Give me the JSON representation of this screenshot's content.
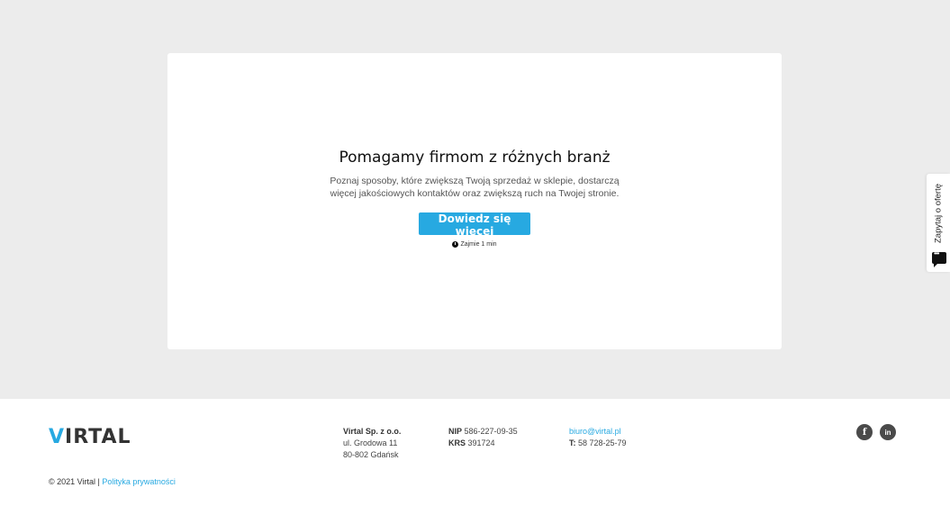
{
  "card": {
    "title": "Pomagamy firmom z różnych branż",
    "description": "Poznaj sposoby, które zwiększą Twoją sprzedaż w sklepie, dostarczą więcej jakościowych kontaktów oraz zwiększą ruch na Twojej stronie.",
    "cta_label": "Dowiedz się więcej",
    "time_note": "Zajmie 1 min"
  },
  "side_tab": {
    "label": "Zapytaj o ofertę"
  },
  "footer": {
    "logo_text": "VIRTAL",
    "company": {
      "name": "Virtal Sp. z o.o.",
      "street": "ul. Grodowa 11",
      "city": "80-802 Gdańsk"
    },
    "ids": {
      "nip_label": "NIP",
      "nip_value": "586-227-09-35",
      "krs_label": "KRS",
      "krs_value": "391724"
    },
    "contact": {
      "email": "biuro@virtal.pl",
      "phone_label": "T:",
      "phone_value": "58 728-25-79"
    },
    "copyright": "© 2021 Virtal |",
    "privacy_link": "Polityka prywatności"
  },
  "colors": {
    "accent": "#27a9e1",
    "background": "#ececec"
  }
}
